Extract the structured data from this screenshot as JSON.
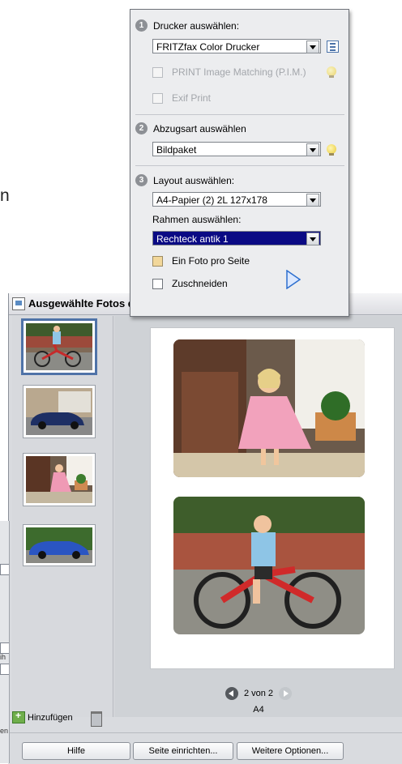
{
  "background_dialog": {
    "title": "Ausgewählte Fotos d",
    "add_label": "Hinzufügen",
    "pager": {
      "current_page": "2 von 2",
      "paper": "A4"
    },
    "buttons": {
      "help": "Hilfe",
      "page_setup": "Seite einrichten...",
      "more_options": "Weitere Optionen..."
    }
  },
  "left_fragments": {
    "frag_1": "ih",
    "frag_2": "en"
  },
  "edge_letter": "n",
  "panel": {
    "step1": {
      "number": "1",
      "title": "Drucker auswählen:",
      "printer": "FRITZfax Color Drucker",
      "pim_label": "PRINT Image Matching (P.I.M.)",
      "exif_label": "Exif Print"
    },
    "step2": {
      "number": "2",
      "title": "Abzugsart auswählen",
      "print_type": "Bildpaket"
    },
    "step3": {
      "number": "3",
      "title": "Layout auswählen:",
      "layout": "A4-Papier (2) 2L 127x178",
      "frame_title": "Rahmen auswählen:",
      "frame": "Rechteck antik 1",
      "one_photo_label": "Ein Foto pro Seite",
      "crop_label": "Zuschneiden"
    }
  },
  "colors": {
    "selection": "#0a0a84",
    "accent_blue": "#4f73a8"
  }
}
